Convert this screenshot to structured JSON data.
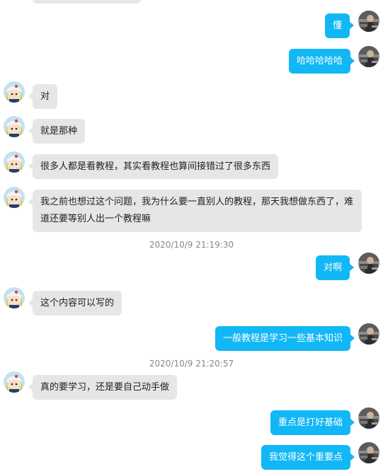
{
  "chat": {
    "messages": [
      {
        "text": "懂"
      },
      {
        "text": "哈哈哈哈哈"
      },
      {
        "text": "对"
      },
      {
        "text": "就是那种"
      },
      {
        "text": "很多人都是看教程，其实看教程也算间接错过了很多东西"
      },
      {
        "text": "我之前也想过这个问题，我为什么要一直别人的教程，那天我想做东西了，难道还要等别人出一个教程嘛"
      },
      {
        "text": "对啊"
      },
      {
        "text": "这个内容可以写的"
      },
      {
        "text": "一般教程是学习一些基本知识"
      },
      {
        "text": "真的要学习，还是要自己动手做"
      },
      {
        "text": "重点是打好基础"
      },
      {
        "text": "我觉得这个重要点"
      }
    ],
    "timestamps": [
      "2020/10/9 21:19:30",
      "2020/10/9 21:20:57"
    ],
    "colors": {
      "self_bubble": "#12b7f5",
      "other_bubble": "#e6e6e6",
      "timestamp_text": "#888888"
    }
  }
}
